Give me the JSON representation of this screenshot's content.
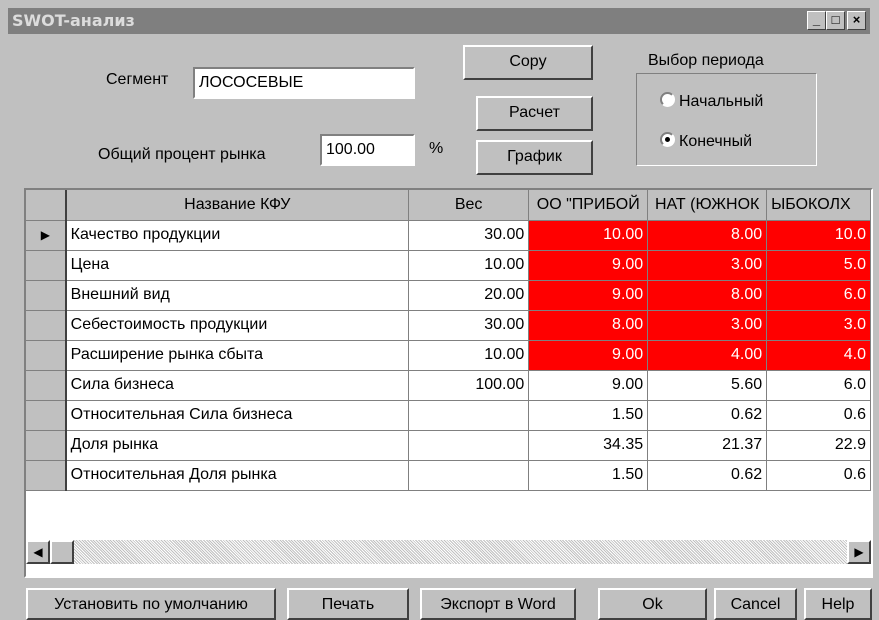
{
  "window": {
    "title": "SWOT-анализ",
    "minimize": "_",
    "maximize": "□",
    "close": "×"
  },
  "form": {
    "segment_label": "Сегмент",
    "segment_value": "ЛОСОСЕВЫЕ",
    "market_label": "Общий процент рынка",
    "market_value": "100.00",
    "market_unit": "%",
    "copy_button": "Copy",
    "calc_button": "Расчет",
    "chart_button": "График",
    "period_title": "Выбор периода",
    "period_options": [
      "Начальный",
      "Конечный"
    ],
    "period_selected": "Конечный"
  },
  "table": {
    "columns": [
      "Название КФУ",
      "Вес",
      "ОО \"ПРИБОЙ",
      "НАТ (ЮЖНОК",
      "ЫБОКОЛХ"
    ],
    "rows": [
      {
        "name": "Качество продукции",
        "weight": "30.00",
        "c1": "10.00",
        "c2": "8.00",
        "c3": "10.0",
        "red": true,
        "current": true
      },
      {
        "name": "Цена",
        "weight": "10.00",
        "c1": "9.00",
        "c2": "3.00",
        "c3": "5.0",
        "red": true
      },
      {
        "name": "Внешний вид",
        "weight": "20.00",
        "c1": "9.00",
        "c2": "8.00",
        "c3": "6.0",
        "red": true
      },
      {
        "name": "Себестоимость продукции",
        "weight": "30.00",
        "c1": "8.00",
        "c2": "3.00",
        "c3": "3.0",
        "red": true
      },
      {
        "name": "Расширение рынка сбыта",
        "weight": "10.00",
        "c1": "9.00",
        "c2": "4.00",
        "c3": "4.0",
        "red": true
      },
      {
        "name": "Сила бизнеса",
        "weight": "100.00",
        "c1": "9.00",
        "c2": "5.60",
        "c3": "6.0",
        "red": false
      },
      {
        "name": "Относительная Сила бизнеса",
        "weight": "",
        "c1": "1.50",
        "c2": "0.62",
        "c3": "0.6",
        "red": false
      },
      {
        "name": "Доля рынка",
        "weight": "",
        "c1": "34.35",
        "c2": "21.37",
        "c3": "22.9",
        "red": false
      },
      {
        "name": "Относительная Доля рынка",
        "weight": "",
        "c1": "1.50",
        "c2": "0.62",
        "c3": "0.6",
        "red": false
      }
    ]
  },
  "footer": {
    "default_button": "Установить по умолчанию",
    "print_button": "Печать",
    "export_button": "Экспорт в Word",
    "ok_button": "Ok",
    "cancel_button": "Cancel",
    "help_button": "Help"
  },
  "colors": {
    "highlight": "#ff0000",
    "face": "#c0c0c0",
    "titlebar": "#7f7f7f"
  }
}
